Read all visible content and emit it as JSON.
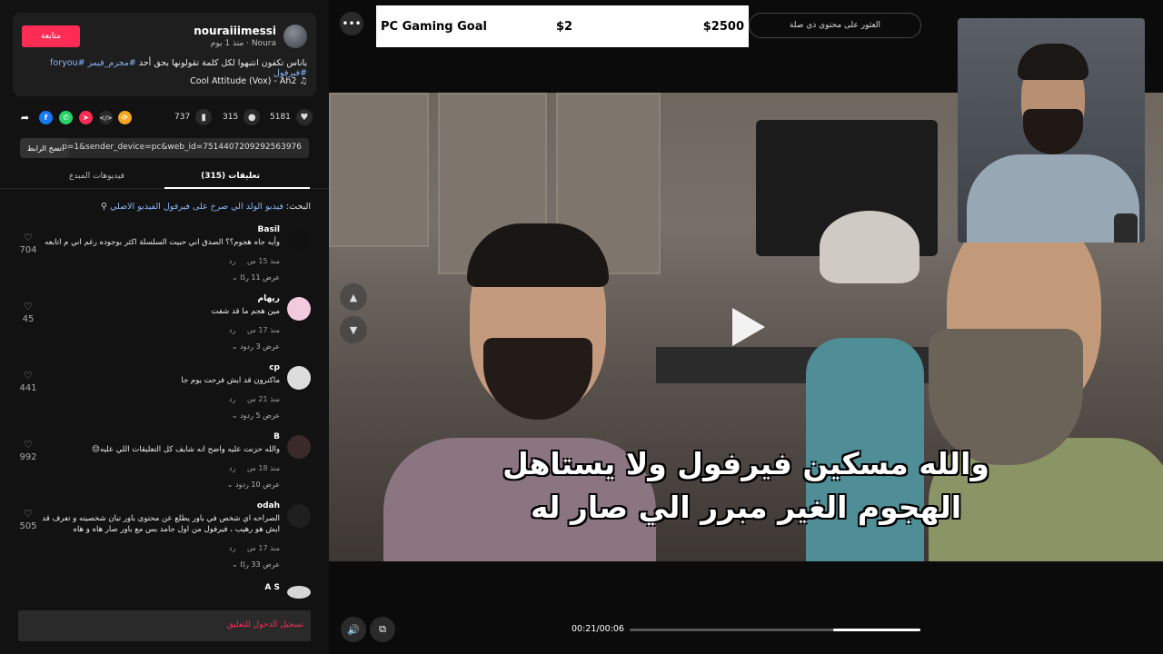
{
  "author": {
    "name": "nouraiiimessi",
    "display_name": "Noura",
    "posted": "منذ 1 يوم",
    "follow_label": "متابعة",
    "caption_text": "ياناس تكفون انتبهوا لكل كلمة تقولونها بحق أحد",
    "hashtags": "#مجرم_قيمز #foryou #فيرفول",
    "music": "Cool Attitude (Vox) - Ah2"
  },
  "actions": {
    "likes": "5181",
    "comments": "315",
    "saves": "737"
  },
  "share": {
    "copy_label": "نسخ الرابط",
    "link": "...p=1&sender_device=pc&web_id=7514407209292563976"
  },
  "tabs": {
    "comments_label": "تعليقات (315)",
    "creator_videos_label": "فيديوهات المبدع"
  },
  "search_hint": {
    "prefix": "البحث:",
    "query": "فيديو الولد الي صرخ على فيرفول الفيديو الاصلي"
  },
  "comments": [
    {
      "name": "Basil",
      "text": "وأيه جاه هجوم؟؟ الصدق اني حبيت السلسلة اكثر بوجوده رغم اني م اتابعه",
      "time": "منذ 15 س",
      "reply": "رد",
      "replies": "عرض 11 ردًا",
      "likes": "704"
    },
    {
      "name": "ريهام",
      "text": "مين هجم ما قد شفت",
      "time": "منذ 17 س",
      "reply": "رد",
      "replies": "عرض 3 ردود",
      "likes": "45"
    },
    {
      "name": "cp",
      "text": "ماكنرون قد ايش فرحت يوم جا",
      "time": "منذ 21 س",
      "reply": "رد",
      "replies": "عرض 5 ردود",
      "likes": "441"
    },
    {
      "name": "B",
      "text": "والله حزنت عليه واضح انه شايف كل التعليقات اللي عليه😔",
      "time": "منذ 18 س",
      "reply": "رد",
      "replies": "عرض 10 ردود",
      "likes": "992"
    },
    {
      "name": "odah",
      "text": "الصراحه اي شخص في باور يطلع عن محتوى باور تبان شخصيته و تعرف قد ايش هو رهيب ، فيرفول من اول جامد بس مع باور صار هاه و هاه",
      "time": "منذ 17 س",
      "reply": "رد",
      "replies": "عرض 33 ردًا",
      "likes": "505"
    },
    {
      "name": "A S",
      "text": "",
      "time": "",
      "reply": "",
      "replies": "",
      "likes": ""
    }
  ],
  "login": {
    "label": "تسجيل الدخول للتعليق"
  },
  "overlay": {
    "goal_title": "PC Gaming Goal",
    "goal_current": "$2",
    "goal_target": "$2500",
    "report_text": "العثور على محتوى ذي صلة"
  },
  "video": {
    "subtitle_line1": "والله مسكين فيرفول ولا يستاهل",
    "subtitle_line2": "الهجوم الغير مبرر الي صار له",
    "time": "00:21/00:06",
    "progress": 0.3
  },
  "colors": {
    "accent": "#fe2c55",
    "link": "#8ab4f8",
    "background": "#121212"
  }
}
